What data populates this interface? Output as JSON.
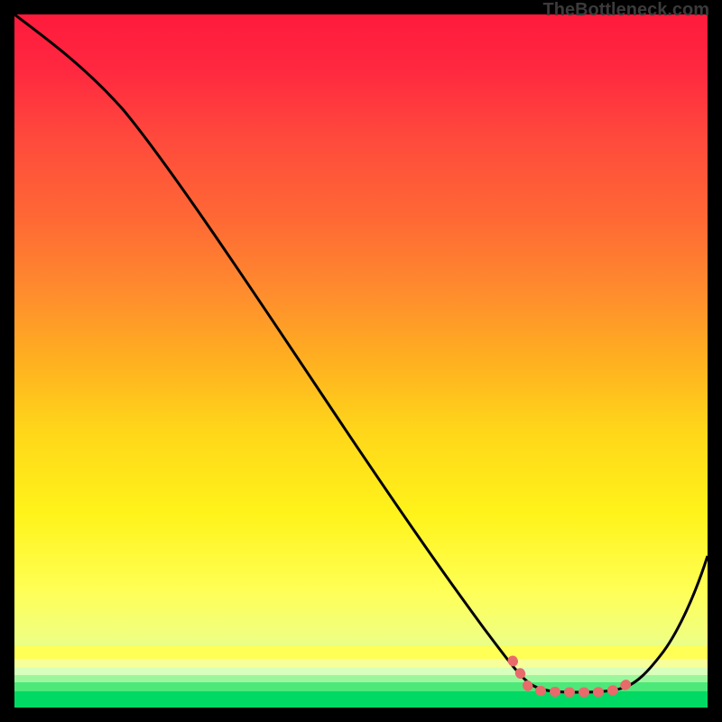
{
  "source_label": "TheBottleneck.com",
  "chart_data": {
    "type": "line",
    "title": "",
    "xlabel": "",
    "ylabel": "",
    "xlim": [
      0,
      100
    ],
    "ylim": [
      0,
      100
    ],
    "x": [
      0,
      3,
      6,
      9,
      12,
      15,
      18,
      21,
      24,
      27,
      30,
      33,
      36,
      39,
      42,
      45,
      48,
      51,
      54,
      57,
      60,
      63,
      66,
      69,
      71,
      73,
      75,
      77,
      79,
      81,
      83,
      85,
      87,
      89,
      91,
      93,
      95,
      97,
      100
    ],
    "y": [
      100,
      96,
      93,
      90,
      86,
      82,
      78,
      74,
      70,
      66,
      62,
      58,
      54,
      50,
      46,
      42,
      38,
      34,
      30,
      26,
      22,
      18,
      14,
      11,
      8,
      5,
      3.5,
      3,
      3,
      3,
      3,
      3,
      3,
      4.5,
      6.5,
      9,
      12,
      16,
      22
    ],
    "optimal_zone": {
      "x_start": 71,
      "x_end": 89
    },
    "background_gradient": [
      "#ff1a3c",
      "#ff6a34",
      "#ffd61a",
      "#ffff55",
      "#00d964"
    ]
  }
}
